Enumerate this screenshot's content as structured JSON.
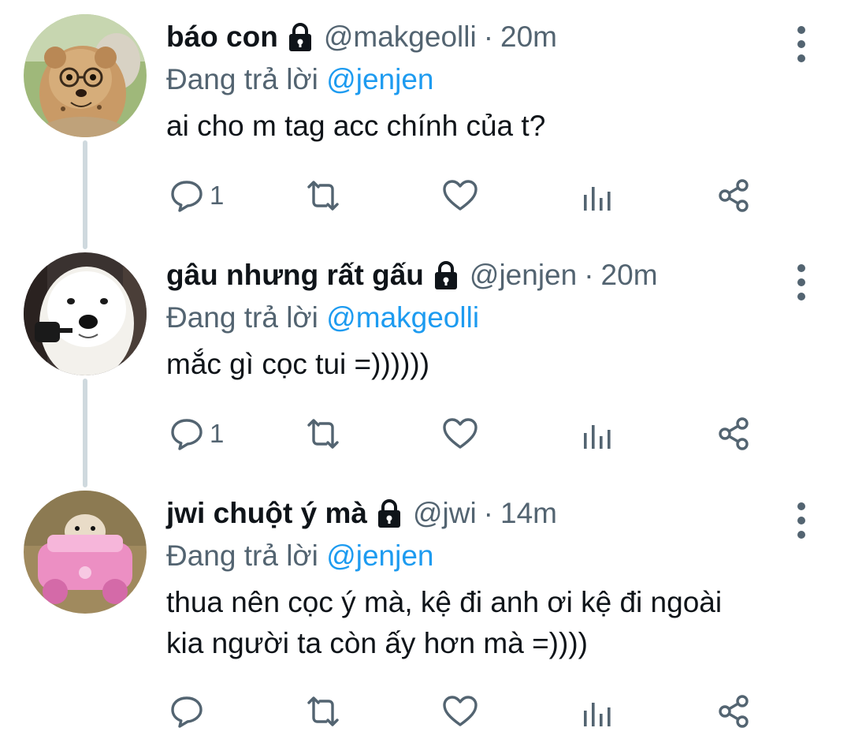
{
  "tweets": [
    {
      "display_name": "báo con",
      "handle": "@makgeolli",
      "separator": "·",
      "time": "20m",
      "replying_prefix": "Đang trả lời",
      "replying_to": "@jenjen",
      "body": "ai cho m tag acc chính của t?",
      "reply_count": "1",
      "avatar": "cheetah-cub-with-glasses"
    },
    {
      "display_name": "gâu nhưng rất gấu",
      "handle": "@jenjen",
      "separator": "·",
      "time": "20m",
      "replying_prefix": "Đang trả lời",
      "replying_to": "@makgeolli",
      "body": "mắc gì cọc tui =))))))",
      "reply_count": "1",
      "avatar": "white-samoyed-dog"
    },
    {
      "display_name": "jwi chuột ý mà",
      "handle": "@jwi",
      "separator": "·",
      "time": "14m",
      "replying_prefix": "Đang trả lời",
      "replying_to": "@jenjen",
      "body_lines": [
        "thua nên cọc ý mà, kệ đi anh ơi kệ đi ngoài",
        "kia người ta còn ấy hơn mà =))))"
      ],
      "reply_count": "",
      "avatar": "hamster-in-pink-toy-car"
    }
  ],
  "icons": [
    "lock-icon",
    "more-vertical-icon",
    "reply-icon",
    "retweet-icon",
    "like-icon",
    "analytics-icon",
    "share-icon"
  ],
  "colors": {
    "text": "#0f1419",
    "secondary": "#536471",
    "link": "#1d9bf0",
    "thread_line": "#cfd9de"
  }
}
